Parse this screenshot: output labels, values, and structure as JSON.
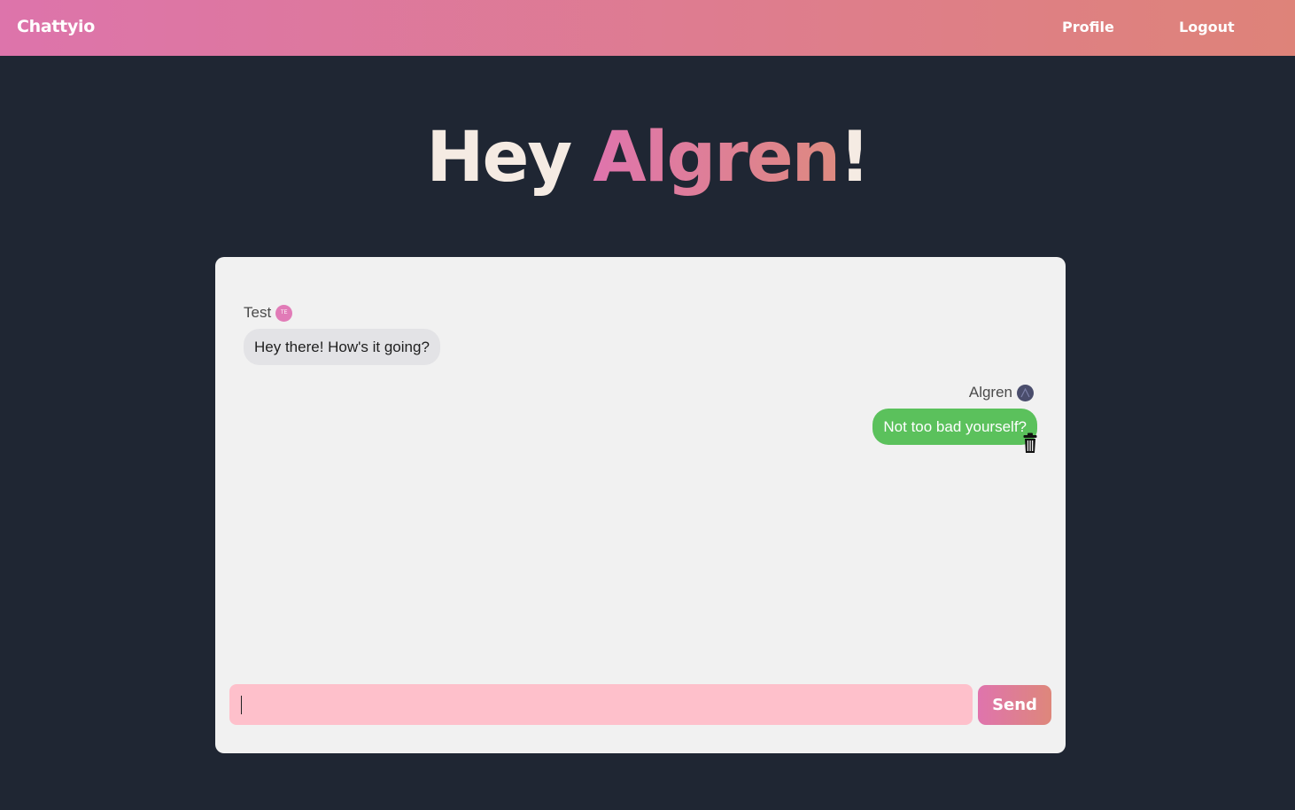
{
  "navbar": {
    "brand": "Chattyio",
    "links": [
      {
        "label": "Profile"
      },
      {
        "label": "Logout"
      }
    ]
  },
  "greeting": {
    "prefix": "Hey ",
    "name": "Algren",
    "suffix": "!"
  },
  "chat": {
    "messages": [
      {
        "author": "Test",
        "avatar_initials": "TE",
        "text": "Hey there! How's it going?",
        "direction": "incoming"
      },
      {
        "author": "Algren",
        "avatar_initials": "",
        "text": "Not too bad yourself?",
        "direction": "outgoing",
        "action_icon": "trash-icon"
      }
    ],
    "composer": {
      "value": "",
      "placeholder": "",
      "send_label": "Send"
    }
  },
  "colors": {
    "nav_gradient_start": "#dd74ab",
    "nav_gradient_end": "#de8379",
    "page_background": "#1f2633",
    "card_background": "#f1f1f1",
    "incoming_bubble": "#e3e3e6",
    "outgoing_bubble": "#5bc15c",
    "composer_background": "#fec0cb"
  }
}
